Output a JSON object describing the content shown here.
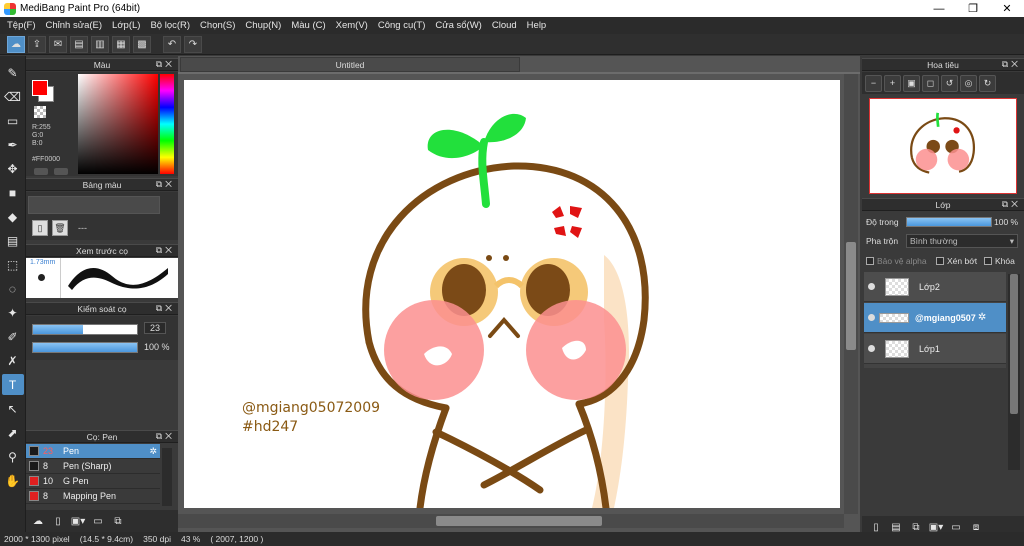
{
  "window": {
    "title": "MediBang Paint Pro (64bit)",
    "min_glyph": "—",
    "max_glyph": "❐",
    "close_glyph": "✕"
  },
  "menu": [
    "Tệp(F)",
    "Chỉnh sửa(E)",
    "Lớp(L)",
    "Bộ lọc(R)",
    "Chọn(S)",
    "Chụp(N)",
    "Màu (C)",
    "Xem(V)",
    "Công cụ(T)",
    "Cửa sổ(W)",
    "Cloud",
    "Help"
  ],
  "toolbar": {
    "icons": [
      "cloud-icon",
      "share-icon",
      "comment-icon",
      "document-icon",
      "page-icon",
      "grid-icon",
      "layout-icon"
    ],
    "undo_glyph": "↶",
    "redo_glyph": "↷"
  },
  "tools": {
    "icons": [
      "brush-icon",
      "eraser-icon",
      "rectangle-icon",
      "pen-tool-icon",
      "move-icon",
      "fill-rect-icon",
      "bucket-icon",
      "gradient-icon",
      "select-icon",
      "lasso-icon",
      "magic-wand-icon",
      "select-pen-icon",
      "select-eraser-icon",
      "text-icon",
      "operation-icon",
      "eyedropper-icon",
      "dropper-icon",
      "hand-icon"
    ],
    "glyphs": [
      "✎",
      "⌫",
      "▭",
      "✒",
      "✥",
      "■",
      "◆",
      "▤",
      "⬚",
      "◌",
      "✦",
      "✐",
      "✗",
      "T",
      "↖",
      "⬈",
      "⚲",
      "✋"
    ],
    "active_index": 13
  },
  "color_panel": {
    "title": "Màu",
    "r": "R:255",
    "g": "G:0",
    "b": "B:0",
    "hex": "#FF0000",
    "fg_color": "#ff0000",
    "bg_color": "#ffffff"
  },
  "palette_panel": {
    "title": "Bảng màu",
    "dash": "---"
  },
  "brush_preview": {
    "title": "Xem trước cọ",
    "size_label": "1.73mm"
  },
  "brush_control": {
    "title": "Kiểm soát cọ",
    "size_value": "23",
    "size_fraction": 0.48,
    "opacity_value": "100 %",
    "opacity_fraction": 1.0
  },
  "brush_list": {
    "title": "Cọ: Pen",
    "items": [
      {
        "size": "23",
        "name": "Pen",
        "color": "#1a1a1a",
        "selected": true
      },
      {
        "size": "8",
        "name": "Pen (Sharp)",
        "color": "#1a1a1a",
        "selected": false
      },
      {
        "size": "10",
        "name": "G Pen",
        "color": "#e02020",
        "selected": false
      },
      {
        "size": "8",
        "name": "Mapping Pen",
        "color": "#e02020",
        "selected": false
      }
    ]
  },
  "document": {
    "tab_title": "Untitled",
    "signature_line1": "@mgiang05072009",
    "signature_line2": "#hd247"
  },
  "navigator": {
    "title": "Hoa tiêu",
    "icons": [
      "zoom-out-icon",
      "zoom-in-icon",
      "fit-icon",
      "actual-size-icon",
      "rotate-left-icon",
      "rotate-reset-icon",
      "rotate-right-icon"
    ],
    "glyphs": [
      "−",
      "+",
      "▣",
      "◻",
      "↺",
      "◎",
      "↻"
    ]
  },
  "layers": {
    "title": "Lớp",
    "opacity_label": "Độ trong",
    "opacity_value": "100 %",
    "opacity_fraction": 1.0,
    "blend_label": "Pha trộn",
    "blend_value": "Bình thường",
    "protect_alpha": "Bảo vệ alpha",
    "clipping": "Xén bớt",
    "lock": "Khóa",
    "items": [
      {
        "name": "Lớp2",
        "selected": false
      },
      {
        "name": "@mgiang0507",
        "selected": true
      },
      {
        "name": "Lớp1",
        "selected": false
      }
    ]
  },
  "status": {
    "size": "2000 * 1300 pixel",
    "cm": "(14.5 * 9.4cm)",
    "dpi": "350 dpi",
    "zoom": "43 %",
    "coords": "( 2007, 1200 )"
  },
  "colors": {
    "accent": "#4f8fc7",
    "sprout": "#22e03c",
    "outline": "#7a4a14",
    "blush": "#fb8f8f",
    "anger": "#e01414",
    "glasses": "#f4c36a"
  }
}
